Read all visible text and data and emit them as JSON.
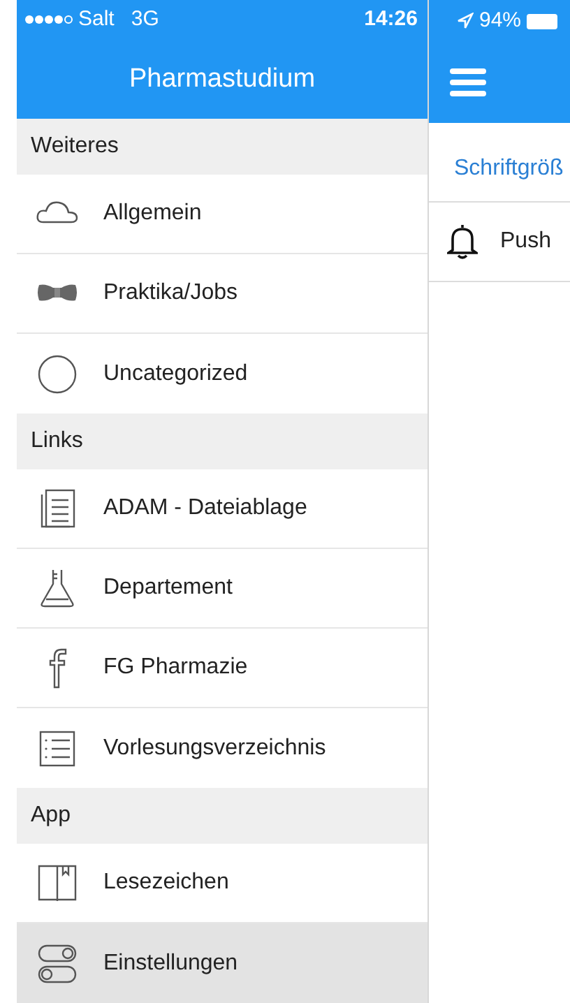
{
  "status_bar": {
    "carrier": "Salt",
    "network": "3G",
    "time": "14:26",
    "battery": "94%"
  },
  "drawer": {
    "title": "Pharmastudium",
    "sections": [
      {
        "title": "Weiteres",
        "items": [
          {
            "label": "Allgemein",
            "selected": false
          },
          {
            "label": "Praktika/Jobs",
            "selected": false
          },
          {
            "label": "Uncategorized",
            "selected": false
          }
        ]
      },
      {
        "title": "Links",
        "items": [
          {
            "label": "ADAM - Dateiablage",
            "selected": false
          },
          {
            "label": "Departement",
            "selected": false
          },
          {
            "label": "FG Pharmazie",
            "selected": false
          },
          {
            "label": "Vorlesungsverzeichnis",
            "selected": false
          }
        ]
      },
      {
        "title": "App",
        "items": [
          {
            "label": "Lesezeichen",
            "selected": false
          },
          {
            "label": "Einstellungen",
            "selected": true
          }
        ]
      }
    ]
  },
  "settings": {
    "rows": [
      {
        "label": "Schriftgröß",
        "kind": "link"
      },
      {
        "label": "Push",
        "kind": "bell"
      }
    ]
  }
}
